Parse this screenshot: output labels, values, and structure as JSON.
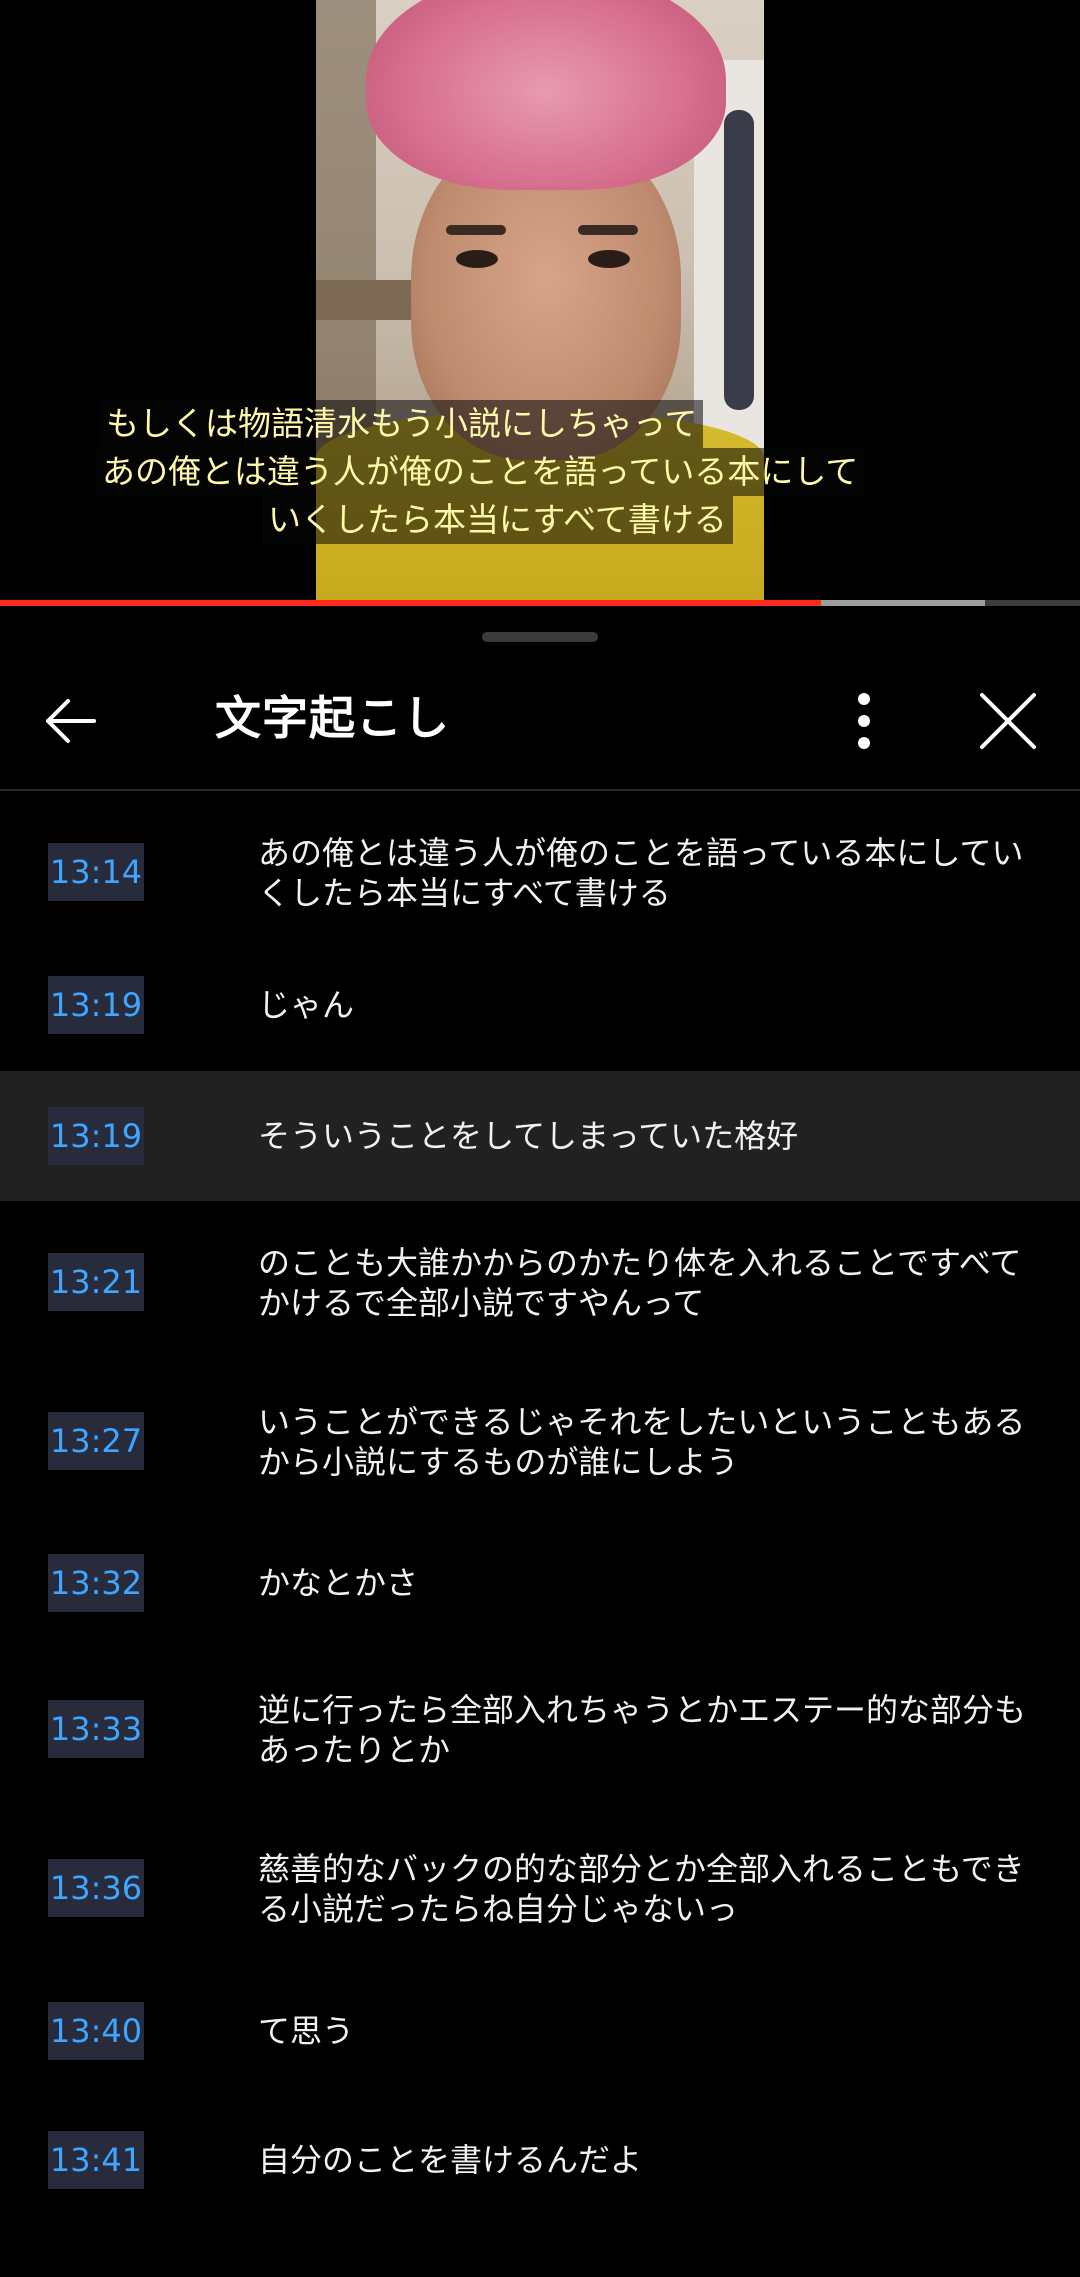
{
  "video": {
    "captions": [
      "もしくは物語清水もう小説にしちゃって",
      "あの俺とは違う人が俺のことを語っている本にして",
      "いくしたら本当にすべて書ける"
    ],
    "progress_played": 0.76,
    "progress_buffered": 0.912,
    "colors": {
      "played": "#ff2a1a",
      "buffered": "#9e9e9e",
      "caption_text": "#fff8a8"
    }
  },
  "panel": {
    "title": "文字起こし",
    "icons": {
      "back": "arrow-left-icon",
      "more": "more-vert-icon",
      "close": "close-icon"
    }
  },
  "transcript": [
    {
      "time": "13:14",
      "text": "あの俺とは違う人が俺のことを語っている本にしていくしたら本当にすべて書ける",
      "active": false
    },
    {
      "time": "13:19",
      "text": "じゃん",
      "active": false
    },
    {
      "time": "13:19",
      "text": "そういうことをしてしまっていた格好",
      "active": true
    },
    {
      "time": "13:21",
      "text": "のことも大誰かからのかたり体を入れることですべてかけるで全部小説ですやんって",
      "active": false
    },
    {
      "time": "13:27",
      "text": "いうことができるじゃそれをしたいということもあるから小説にするものが誰にしよう",
      "active": false
    },
    {
      "time": "13:32",
      "text": "かなとかさ",
      "active": false
    },
    {
      "time": "13:33",
      "text": "逆に行ったら全部入れちゃうとかエステー的な部分もあったりとか",
      "active": false
    },
    {
      "time": "13:36",
      "text": "慈善的なバックの的な部分とか全部入れることもできる小説だったらね自分じゃないっ",
      "active": false
    },
    {
      "time": "13:40",
      "text": "て思う",
      "active": false
    },
    {
      "time": "13:41",
      "text": "自分のことを書けるんだよ",
      "active": false
    }
  ]
}
